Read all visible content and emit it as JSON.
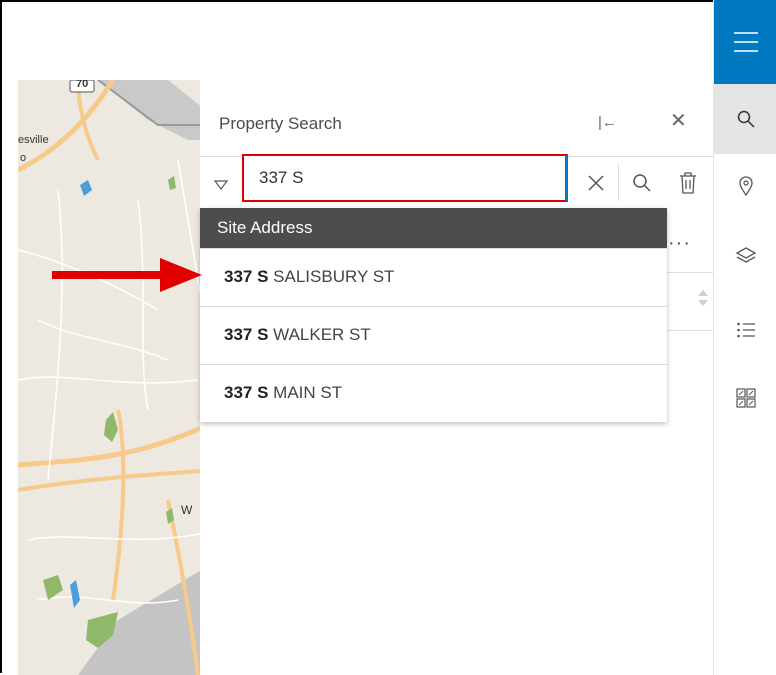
{
  "map": {
    "label_city": "esville",
    "label_dot": "o",
    "label_route": "70",
    "label_edge": "W"
  },
  "panel": {
    "title": "Property Search",
    "collapse_glyph": "|←",
    "close_glyph": "✕"
  },
  "search": {
    "value": "337 S",
    "placeholder": ""
  },
  "dropdown": {
    "header": "Site Address",
    "items": [
      {
        "match": "337 S",
        "rest": " SALISBURY ST"
      },
      {
        "match": "337 S",
        "rest": " WALKER ST"
      },
      {
        "match": "337 S",
        "rest": " MAIN ST"
      }
    ]
  },
  "colors": {
    "accent": "#0079c1",
    "highlight_border": "#e00000",
    "annotation_arrow": "#e00000",
    "dropdown_header": "#4d4d4d"
  }
}
